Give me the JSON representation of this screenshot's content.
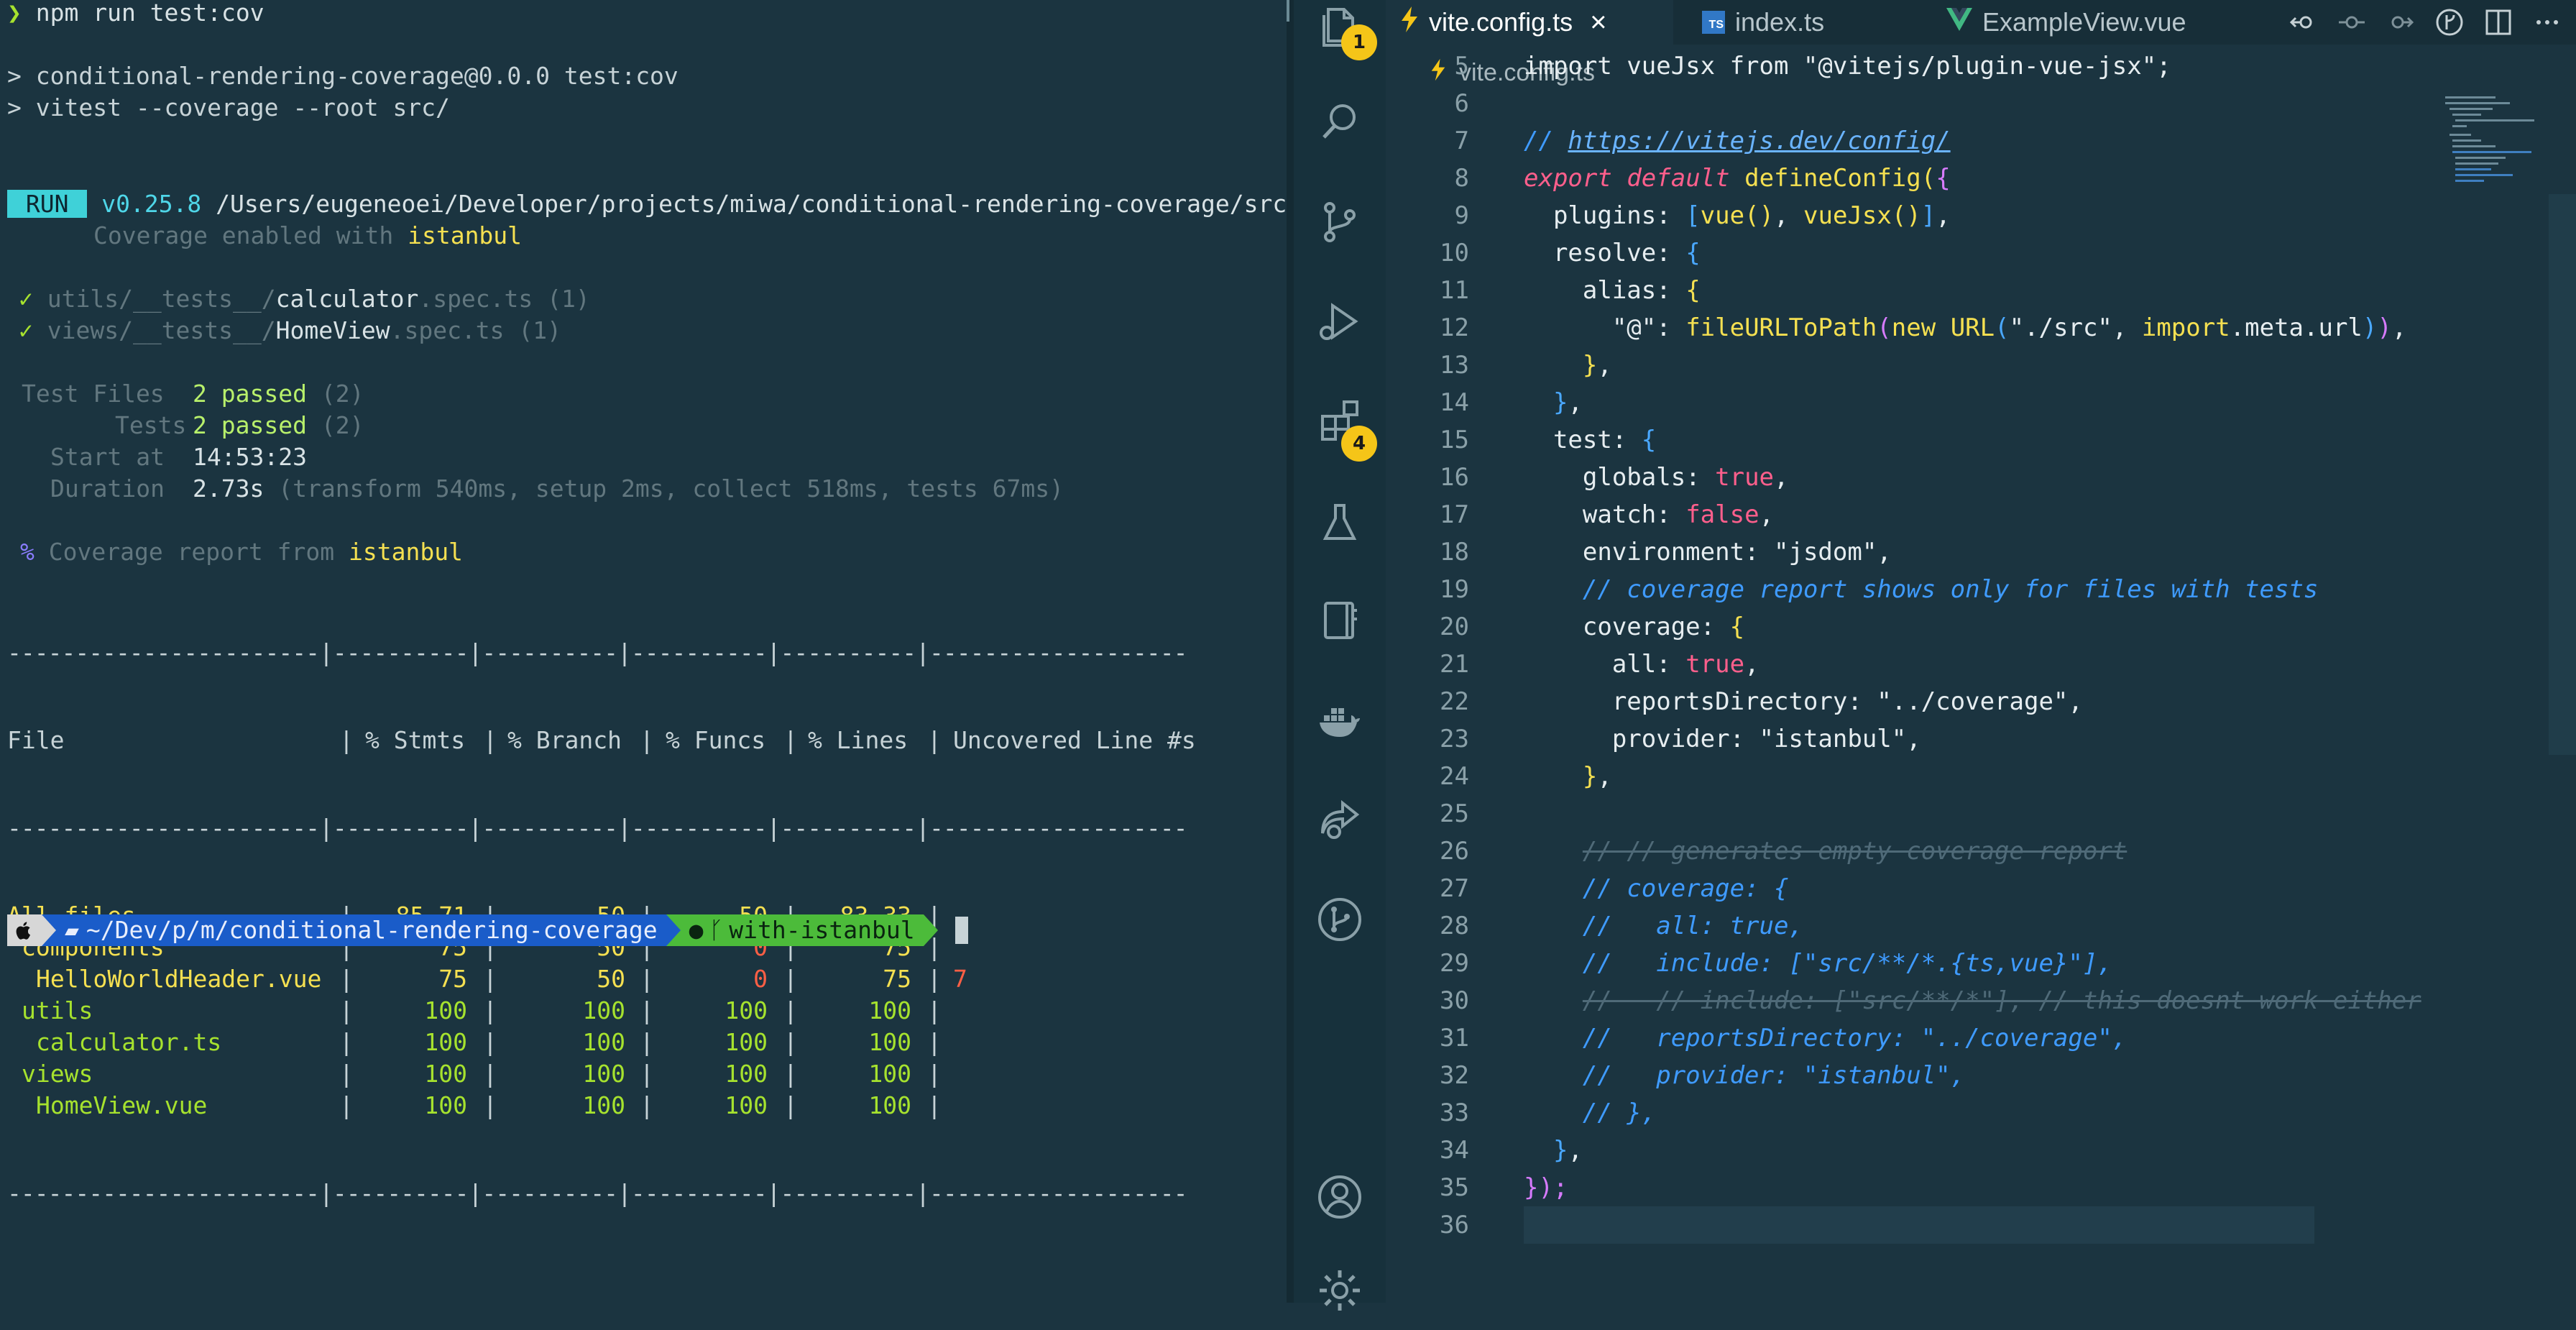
{
  "terminal": {
    "lines": [
      {
        "a": "❯ ",
        "b": "npm run test:cov"
      },
      {
        "a": "> ",
        "b": "conditional-rendering-coverage@0.0.0 test:cov"
      },
      {
        "a": "> ",
        "b": "vitest --coverage --root src/"
      }
    ],
    "run_badge": " RUN ",
    "run_version": "v0.25.8",
    "run_path": "/Users/eugeneoei/Developer/projects/miwa/conditional-rendering-coverage/src",
    "coverage_enabled_prefix": "Coverage enabled with ",
    "coverage_enabled_tool": "istanbul",
    "spec1": {
      "check": "✓",
      "dir": "utils/__tests__/",
      "name": "calculator",
      "ext": ".spec.ts",
      "count": "(1)"
    },
    "spec2": {
      "check": "✓",
      "dir": "views/__tests__/",
      "name": "HomeView",
      "ext": ".spec.ts",
      "count": "(1)"
    },
    "test_files_label": "Test Files",
    "test_files_value": "2 passed",
    "test_files_count": "(2)",
    "tests_label": "Tests",
    "tests_value": "2 passed",
    "tests_count": "(2)",
    "start_label": "Start at",
    "start_value": "14:53:23",
    "duration_label": "Duration",
    "duration_value": "2.73s",
    "duration_detail": "(transform 540ms, setup 2ms, collect 518ms, tests 67ms)",
    "coverage_percent_sign": "%",
    "coverage_report_text": "Coverage report from ",
    "coverage_report_tool": "istanbul",
    "table_rule": "-----------------------|----------|----------|----------|----------|-------------------",
    "table_headers": [
      "File",
      "% Stmts",
      "% Branch",
      "% Funcs",
      "% Lines",
      "Uncovered Line #s"
    ],
    "table_rows": [
      {
        "file": "All files",
        "indent": 0,
        "stmts": "85.71",
        "branch": "50",
        "funcs": "50",
        "lines": "83.33",
        "uncovered": "",
        "level": "mid",
        "funcs_level": "mid"
      },
      {
        "file": "components",
        "indent": 1,
        "stmts": "75",
        "branch": "50",
        "funcs": "0",
        "lines": "75",
        "uncovered": "",
        "level": "mid",
        "funcs_level": "low"
      },
      {
        "file": "HelloWorldHeader.vue",
        "indent": 2,
        "stmts": "75",
        "branch": "50",
        "funcs": "0",
        "lines": "75",
        "uncovered": "7",
        "level": "mid",
        "funcs_level": "low"
      },
      {
        "file": "utils",
        "indent": 1,
        "stmts": "100",
        "branch": "100",
        "funcs": "100",
        "lines": "100",
        "uncovered": "",
        "level": "high",
        "funcs_level": "high"
      },
      {
        "file": "calculator.ts",
        "indent": 2,
        "stmts": "100",
        "branch": "100",
        "funcs": "100",
        "lines": "100",
        "uncovered": "",
        "level": "high",
        "funcs_level": "high"
      },
      {
        "file": "views",
        "indent": 1,
        "stmts": "100",
        "branch": "100",
        "funcs": "100",
        "lines": "100",
        "uncovered": "",
        "level": "high",
        "funcs_level": "high"
      },
      {
        "file": "HomeView.vue",
        "indent": 2,
        "stmts": "100",
        "branch": "100",
        "funcs": "100",
        "lines": "100",
        "uncovered": "",
        "level": "high",
        "funcs_level": "high"
      }
    ],
    "prompt": {
      "apple_icon": "apple-icon",
      "dir": "~/Dev/p/m/conditional-rendering-coverage",
      "branch": "with-istanbul",
      "colors": {
        "dir_bg": "#1a5cc9",
        "git_bg": "#4cbb3a"
      }
    }
  },
  "activity_bar": {
    "items": [
      {
        "name": "explorer",
        "icon": "files-icon",
        "badge": "1"
      },
      {
        "name": "search",
        "icon": "search-icon"
      },
      {
        "name": "source-control",
        "icon": "source-control-icon"
      },
      {
        "name": "run-debug",
        "icon": "run-debug-icon"
      },
      {
        "name": "extensions",
        "icon": "extensions-icon",
        "badge": "4"
      },
      {
        "name": "testing",
        "icon": "beaker-icon"
      },
      {
        "name": "notebook",
        "icon": "notebook-icon"
      },
      {
        "name": "docker",
        "icon": "docker-icon"
      },
      {
        "name": "live-share",
        "icon": "live-share-icon"
      },
      {
        "name": "git-graph",
        "icon": "git-graph-icon"
      }
    ],
    "bottom": [
      {
        "name": "accounts",
        "icon": "account-icon"
      },
      {
        "name": "manage",
        "icon": "gear-icon"
      }
    ]
  },
  "editor": {
    "tabs": [
      {
        "label": "vite.config.ts",
        "icon": "vite-icon",
        "active": true,
        "close": "×"
      },
      {
        "label": "index.ts",
        "icon": "ts-file-icon",
        "active": false
      },
      {
        "label": "ExampleView.vue",
        "icon": "vue-icon",
        "active": false
      }
    ],
    "breadcrumb": "vite.config.ts",
    "line_numbers": [
      "5",
      "6",
      "7",
      "8",
      "9",
      "10",
      "11",
      "12",
      "13",
      "14",
      "15",
      "16",
      "17",
      "18",
      "19",
      "20",
      "21",
      "22",
      "23",
      "24",
      "25",
      "26",
      "27",
      "28",
      "29",
      "30",
      "31",
      "32",
      "33",
      "34",
      "35",
      "36"
    ],
    "code": {
      "l5": "import vueJsx from \"@vitejs/plugin-vue-jsx\";",
      "l7_prefix": "// ",
      "l7_url": "https://vitejs.dev/config/",
      "l8_export": "export",
      "l8_default": "default",
      "l8_fn": "defineConfig",
      "l9_key": "plugins: ",
      "l9_vue": "vue",
      "l9_vuejsx": "vueJsx",
      "l10": "resolve: ",
      "l11": "alias: ",
      "l12_key": "\"@\": ",
      "l12_fn": "fileURLToPath",
      "l12_new": "new",
      "l12_url": "URL",
      "l12_str": "\"./src\"",
      "l12_import": "import",
      "l12_meta": ".meta.url",
      "l15": "test: ",
      "l16_key": "globals: ",
      "l16_val": "true",
      "l17_key": "watch: ",
      "l17_val": "false",
      "l18_key": "environment: ",
      "l18_val": "\"jsdom\"",
      "l19": "// coverage report shows only for files with tests",
      "l20": "coverage: ",
      "l21_key": "all: ",
      "l21_val": "true",
      "l22_key": "reportsDirectory: ",
      "l22_val": "\"../coverage\"",
      "l23_key": "provider: ",
      "l23_val": "\"istanbul\"",
      "l26": "// // generates empty coverage report",
      "l27": "// coverage: {",
      "l28": "//   all: true,",
      "l29": "//   include: [\"src/**/*.{ts,vue}\"],",
      "l30": "//   // include: [\"src/**/*\"], // this doesnt work either",
      "l31": "//   reportsDirectory: \"../coverage\",",
      "l32": "//   provider: \"istanbul\",",
      "l33": "// },",
      "l35_close": "});"
    }
  },
  "colors": {
    "bg": "#1b3440",
    "accent_yellow": "#f5e051",
    "accent_green": "#a6e22e",
    "accent_red": "#ff5f45",
    "badge": "#f5c518"
  }
}
